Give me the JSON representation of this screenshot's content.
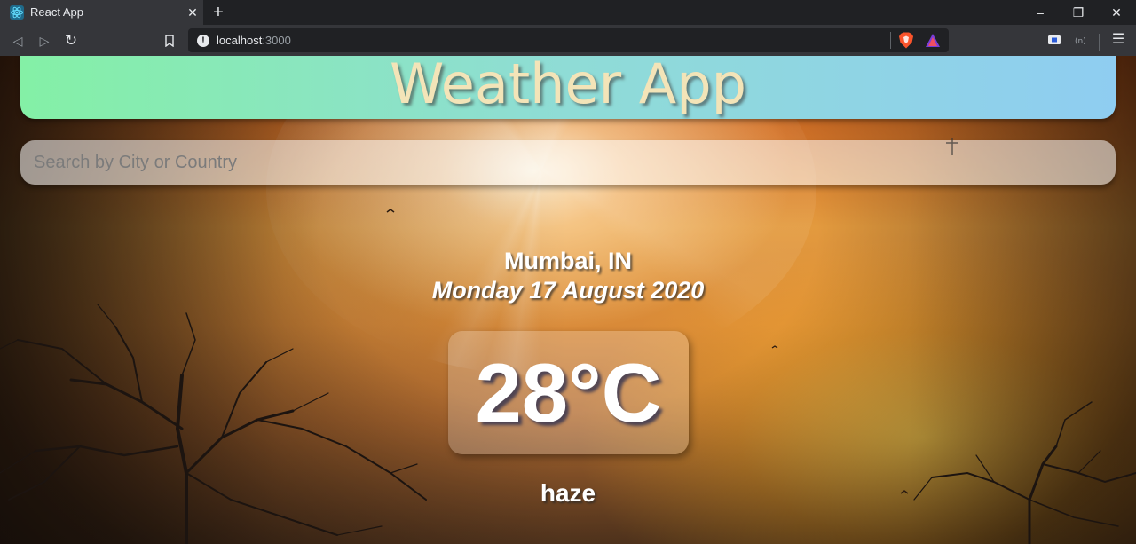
{
  "browser": {
    "tab_title": "React App",
    "tab_close_icon": "close-icon",
    "new_tab_label": "+",
    "url_host": "localhost",
    "url_port": ":3000",
    "menu_glyph": "☰",
    "window": {
      "minimize": "–",
      "restore": "❐",
      "close": "✕"
    },
    "nav": {
      "back": "◁",
      "forward": "▷",
      "reload": "↻",
      "bookmark": "⌑"
    }
  },
  "app": {
    "title": "Weather App",
    "search": {
      "placeholder": "Search by City or Country",
      "value": ""
    },
    "location": "Mumbai, IN",
    "date": "Monday 17 August 2020",
    "temperature": "28°C",
    "condition": "haze"
  },
  "colors": {
    "header_gradient_start": "#84f0a6",
    "header_gradient_end": "#8fcdf1",
    "title_color": "#f3e4b8",
    "text_color": "#ffffff"
  }
}
